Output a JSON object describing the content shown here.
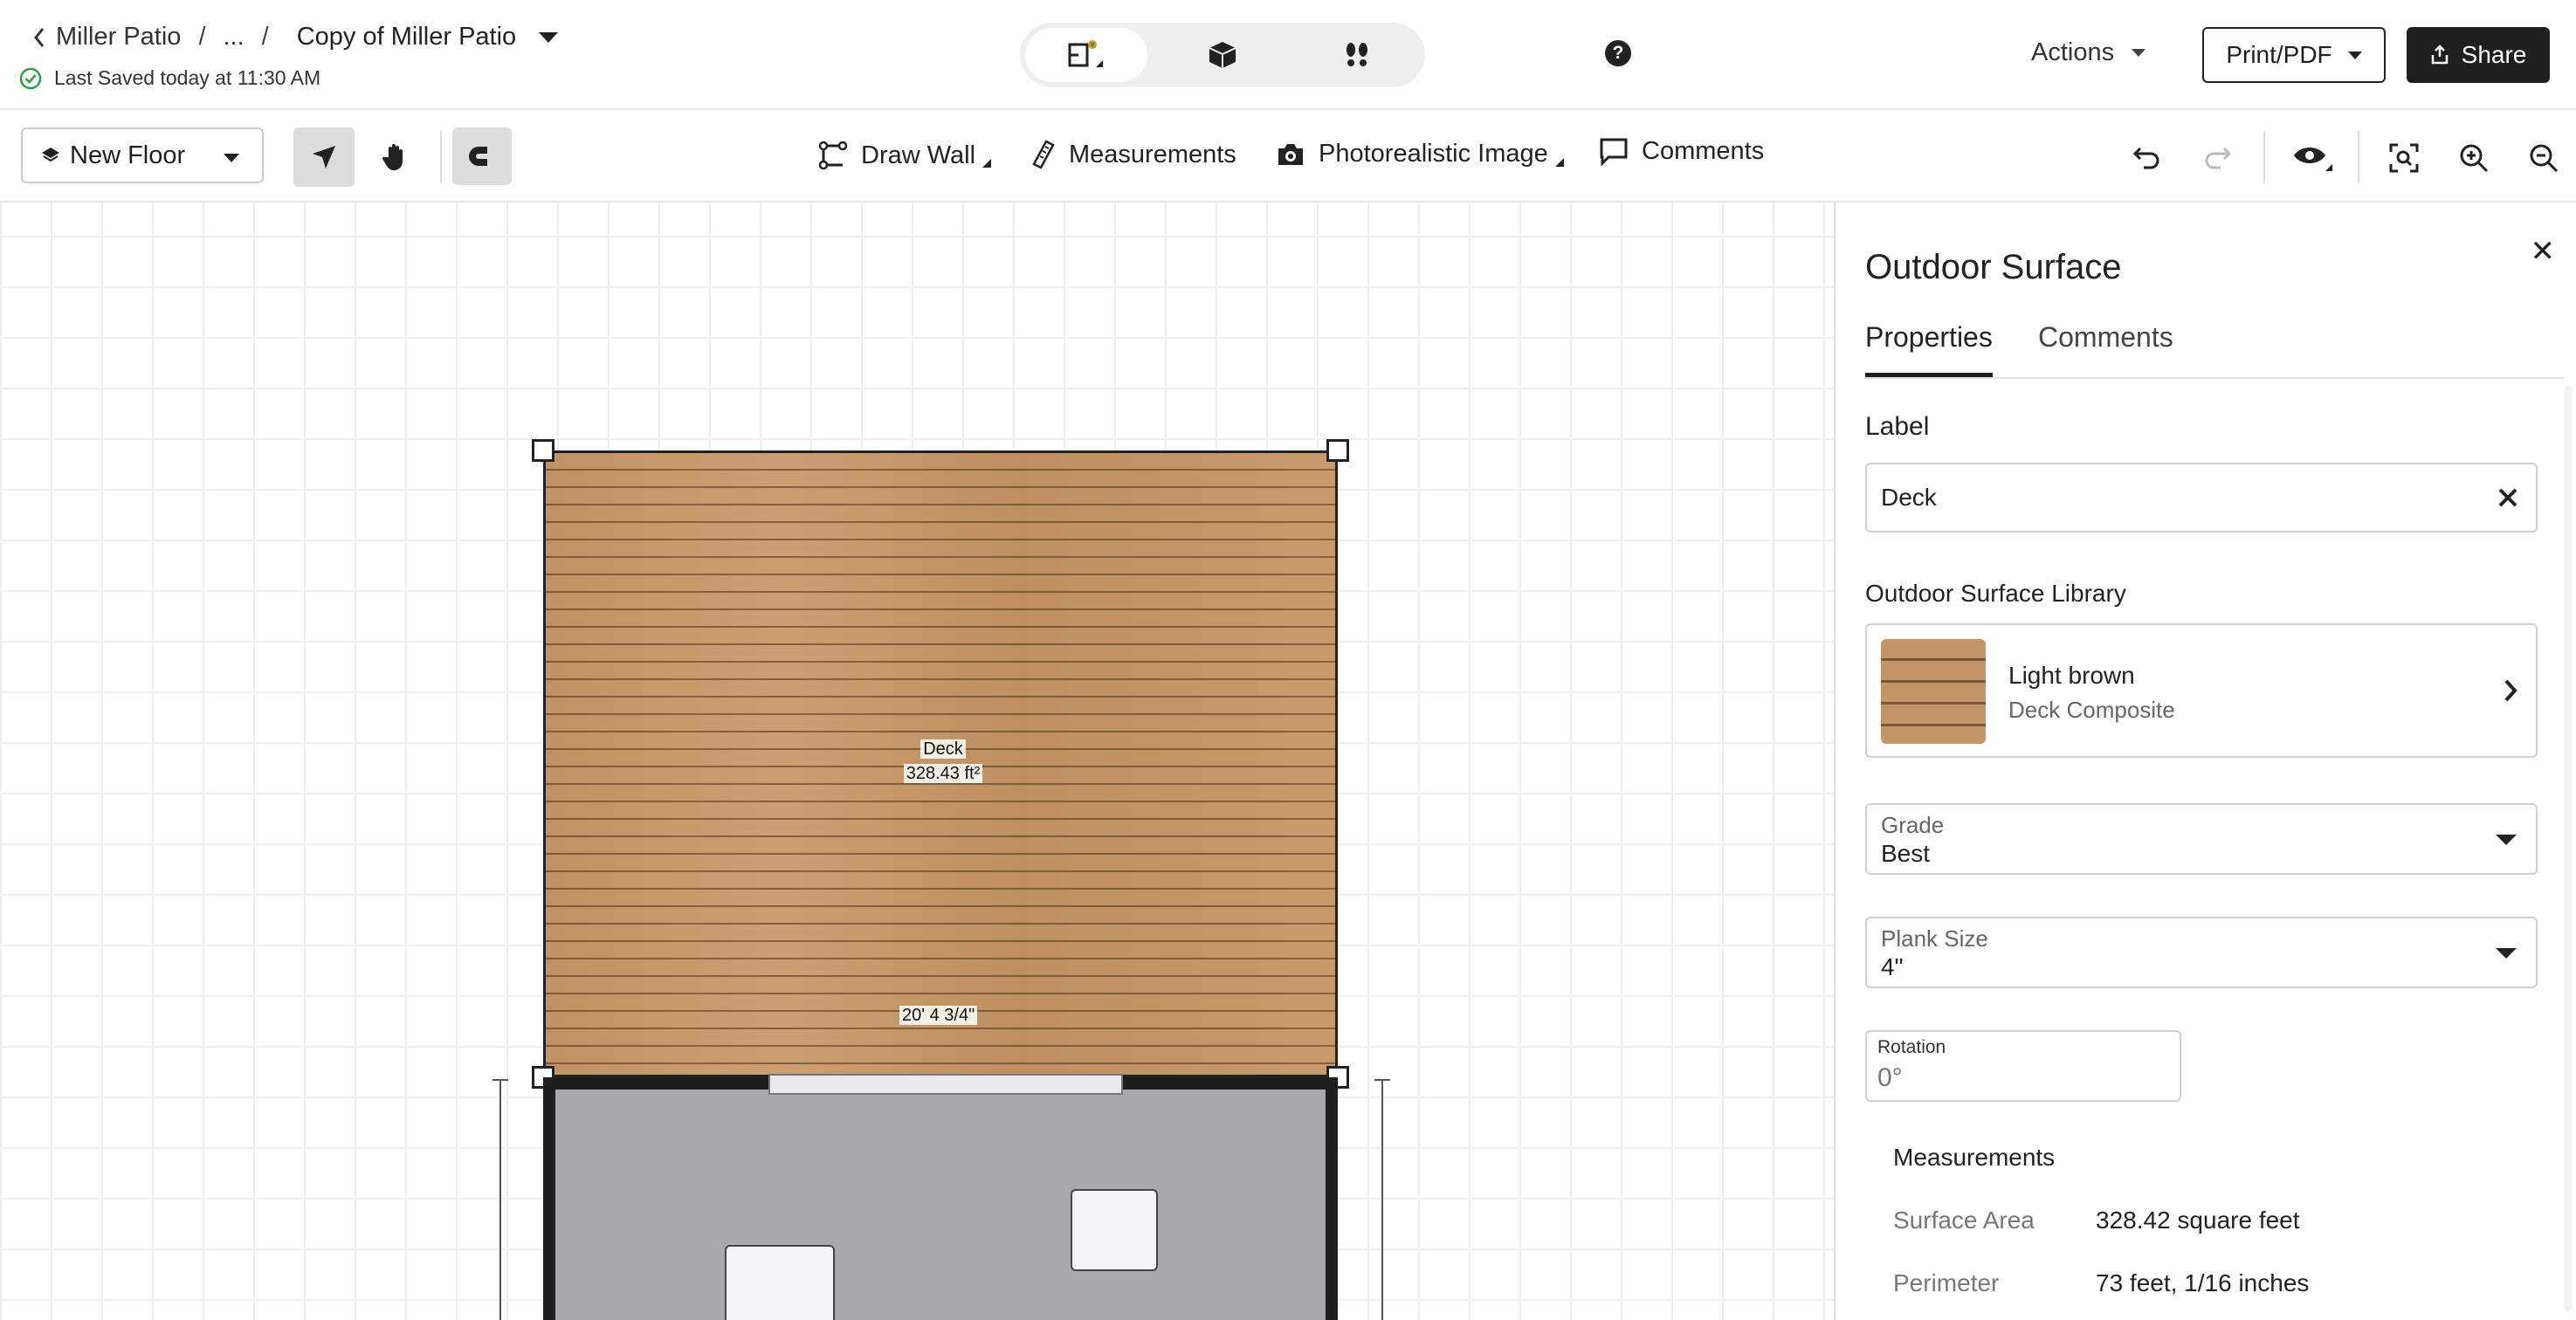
{
  "header": {
    "breadcrumb": {
      "parent": "Miller Patio",
      "ellipsis": "...",
      "current": "Copy of Miller Patio"
    },
    "saved_status": "Last Saved today at 11:30 AM",
    "view_modes": [
      "2d-floorplan-icon",
      "3d-box-icon",
      "walkthrough-footprints-icon"
    ],
    "help": "?",
    "actions_label": "Actions",
    "print_label": "Print/PDF",
    "share_label": "Share"
  },
  "toolbar": {
    "floor_selector": "New Floor",
    "tools": {
      "draw_wall": "Draw Wall",
      "measurements": "Measurements",
      "photorealistic": "Photorealistic Image",
      "comments": "Comments"
    }
  },
  "canvas": {
    "deck_label": "Deck",
    "deck_area": "328.43 ft²",
    "deck_dimension": "20' 4 3/4\""
  },
  "panel": {
    "title": "Outdoor Surface",
    "tabs": [
      "Properties",
      "Comments"
    ],
    "label_heading": "Label",
    "label_value": "Deck",
    "library_heading": "Outdoor Surface Library",
    "library_item_name": "Light brown",
    "library_item_type": "Deck Composite",
    "grade_label": "Grade",
    "grade_value": "Best",
    "plank_label": "Plank Size",
    "plank_value": "4\"",
    "rotation_label": "Rotation",
    "rotation_value": "0°",
    "measurements_heading": "Measurements",
    "measurements": [
      {
        "key": "Surface Area",
        "value": "328.42 square feet"
      },
      {
        "key": "Perimeter",
        "value": "73 feet, 1/16 inches"
      }
    ]
  },
  "colors": {
    "accent_dark": "#1f1f1f",
    "deck_wood": "#c49566",
    "room_floor": "#a6a9ae",
    "saved_check": "#2e9e44"
  }
}
